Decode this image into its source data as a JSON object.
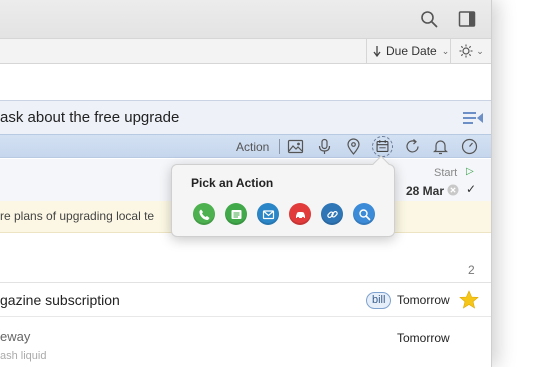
{
  "toolbar": {
    "sort_label": "Due Date",
    "sort_icon": "arrow-down-icon",
    "view_icon": "sun-icon"
  },
  "selected_task": {
    "title": "ask about the free upgrade",
    "action_label": "Action",
    "action_icons": [
      "photo-icon",
      "microphone-icon",
      "location-pin-icon",
      "calendar-action-icon",
      "repeat-icon",
      "bell-icon",
      "clock-icon"
    ],
    "start_label": "Start",
    "due_date": "28 Mar",
    "notes": "re plans of upgrading local te"
  },
  "popover": {
    "title": "Pick an Action",
    "actions": [
      {
        "name": "call-action",
        "icon": "phone-icon",
        "color": "#4db14f"
      },
      {
        "name": "message-action",
        "icon": "message-icon",
        "color": "#41a94a"
      },
      {
        "name": "email-action",
        "icon": "envelope-icon",
        "color": "#2b86c8"
      },
      {
        "name": "drive-action",
        "icon": "car-icon",
        "color": "#e23b3b"
      },
      {
        "name": "link-action",
        "icon": "link-icon",
        "color": "#2f76b7"
      },
      {
        "name": "search-action",
        "icon": "magnifier-icon",
        "color": "#3c8bd8"
      }
    ]
  },
  "list": {
    "count": "2",
    "tasks": [
      {
        "title": "gazine subscription",
        "tag": "bill",
        "due": "Tomorrow",
        "starred": true
      },
      {
        "title": "eway",
        "subtitle": "ash liquid",
        "due": "Tomorrow",
        "starred": false
      }
    ]
  },
  "colors": {
    "selection": "#c6d6ec",
    "notes_bg": "#fbf7e4",
    "star": "#f5c518",
    "accent": "#5b86c4"
  }
}
